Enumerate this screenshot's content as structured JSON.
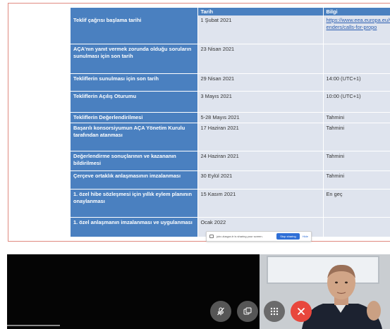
{
  "table": {
    "headers": [
      "",
      "Tarih",
      "Bilgi"
    ],
    "rows": [
      {
        "event": "Teklif çağrısı başlama tarihi",
        "date": "1 Şubat 2021",
        "info": "https://www.eea.europa.eu/tenders/calls-for-propo",
        "info_is_link": true
      },
      {
        "event": "AÇA'nın yanıt vermek zorunda olduğu soruların sunulması için son tarih",
        "date": "23 Nisan 2021",
        "info": ""
      },
      {
        "event": "Tekliflerin sunulması için son tarih",
        "date": "29 Nisan 2021",
        "info": "14:00 (UTC+1)"
      },
      {
        "event": "Tekliflerin Açılış Oturumu",
        "date": "3 Mayıs 2021",
        "info": "10:00 (UTC+1)"
      },
      {
        "event": "Tekliflerin Değerlendirilmesi",
        "date": "5-28 Mayıs 2021",
        "info": "Tahmini"
      },
      {
        "event": "Başarılı konsorsiyumun AÇA Yönetim Kurulu tarafından atanması",
        "date": "17 Haziran 2021",
        "info": "Tahmini"
      },
      {
        "event": "Değerlendirme sonuçlarının ve kazananın bildirilmesi",
        "date": "24 Haziran 2021",
        "info": "Tahmini"
      },
      {
        "event": "Çerçeve ortaklık anlaşmasının imzalanması",
        "date": "30 Eylül 2021",
        "info": "Tahmini"
      },
      {
        "event": "1. özel hibe sözleşmesi için yıllık eylem planının onaylanması",
        "date": "15 Kasım 2021",
        "info": "En geç"
      },
      {
        "event": "1. özel anlaşmanın imzalanması ve uygulanması",
        "date": "Ocak 2022",
        "info": ""
      }
    ]
  },
  "share_banner": {
    "message": "join.ulusgov.tr is sharing your screen.",
    "stop_label": "Stop sharing",
    "hide_label": "Hide"
  },
  "controls": {
    "icons": [
      "mic-off-icon",
      "tile-view-icon",
      "grid-dots-icon",
      "hangup-icon"
    ]
  },
  "colors": {
    "table_header": "#4a80c0",
    "table_cell": "#dfe4ee",
    "link": "#2a5db0",
    "hangup": "#e8473d",
    "share_border": "#e08a80"
  }
}
